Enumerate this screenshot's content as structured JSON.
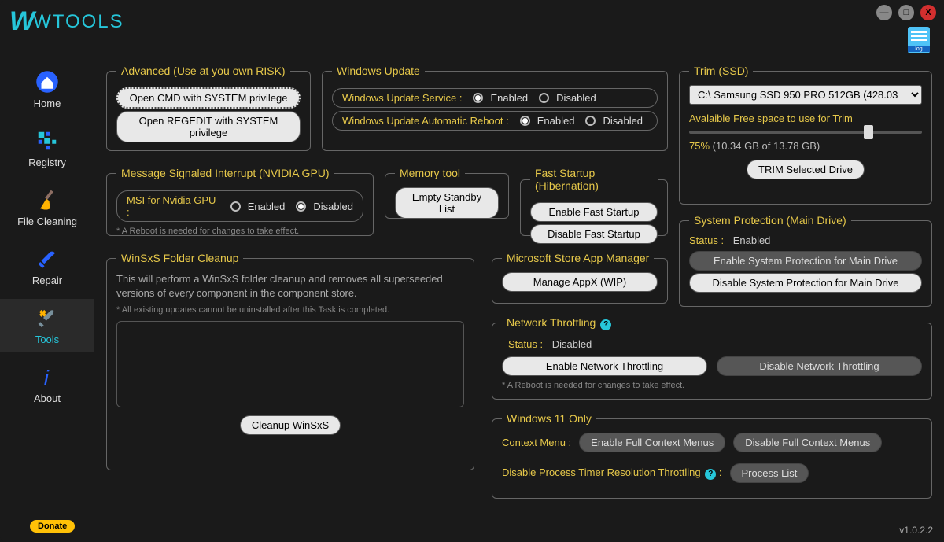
{
  "app": {
    "title": "WTOOLS"
  },
  "titlebar": {
    "close": "X"
  },
  "log": {
    "label": "log"
  },
  "version": "v1.0.2.2",
  "donate": "Donate",
  "sidebar": {
    "items": [
      {
        "label": "Home"
      },
      {
        "label": "Registry"
      },
      {
        "label": "File Cleaning"
      },
      {
        "label": "Repair"
      },
      {
        "label": "Tools"
      },
      {
        "label": "About"
      }
    ]
  },
  "advanced": {
    "legend": "Advanced (Use at you own RISK)",
    "cmd": "Open CMD with SYSTEM privilege",
    "regedit": "Open REGEDIT with SYSTEM privilege"
  },
  "winupdate": {
    "legend": "Windows Update",
    "service_label": "Windows Update Service :",
    "reboot_label": "Windows Update Automatic Reboot :",
    "enabled": "Enabled",
    "disabled": "Disabled",
    "service_value": "Enabled",
    "reboot_value": "Enabled"
  },
  "trim": {
    "legend": "Trim (SSD)",
    "drive": "C:\\ Samsung SSD 950 PRO 512GB (428.03",
    "free_label": "Avalaible Free space to use for Trim",
    "pct": "75%",
    "detail": "(10.34 GB of 13.78 GB)",
    "button": "TRIM Selected Drive",
    "slider_pct": 75
  },
  "msi": {
    "legend": "Message Signaled Interrupt (NVIDIA GPU)",
    "label": "MSI for Nvidia GPU :",
    "enabled": "Enabled",
    "disabled": "Disabled",
    "value": "Disabled",
    "note": "* A Reboot is needed for changes to take effect."
  },
  "memory": {
    "legend": "Memory tool",
    "button": "Empty Standby List"
  },
  "fast": {
    "legend": "Fast Startup (Hibernation)",
    "enable": "Enable Fast Startup",
    "disable": "Disable Fast Startup"
  },
  "winsxs": {
    "legend": "WinSxS Folder Cleanup",
    "desc": "This will perform a WinSxS folder cleanup and removes all superseeded versions of every component in the component store.",
    "note": "* All existing updates cannot be uninstalled after this Task is completed.",
    "button": "Cleanup WinSxS"
  },
  "appmgr": {
    "legend": "Microsoft Store App Manager",
    "button": "Manage AppX (WIP)"
  },
  "sysprot": {
    "legend": "System Protection (Main Drive)",
    "status_label": "Status :",
    "status_value": "Enabled",
    "enable": "Enable System Protection for Main Drive",
    "disable": "Disable System Protection for Main Drive"
  },
  "netthrottle": {
    "legend": "Network Throttling",
    "status_label": "Status :",
    "status_value": "Disabled",
    "enable": "Enable Network Throttling",
    "disable": "Disable Network Throttling",
    "note": "* A Reboot is needed for changes to take effect."
  },
  "win11": {
    "legend": "Windows 11 Only",
    "ctx_label": "Context Menu :",
    "ctx_enable": "Enable Full Context Menus",
    "ctx_disable": "Disable Full Context Menus",
    "timer_label": "Disable Process Timer Resolution Throttling",
    "timer_btn": "Process List"
  }
}
